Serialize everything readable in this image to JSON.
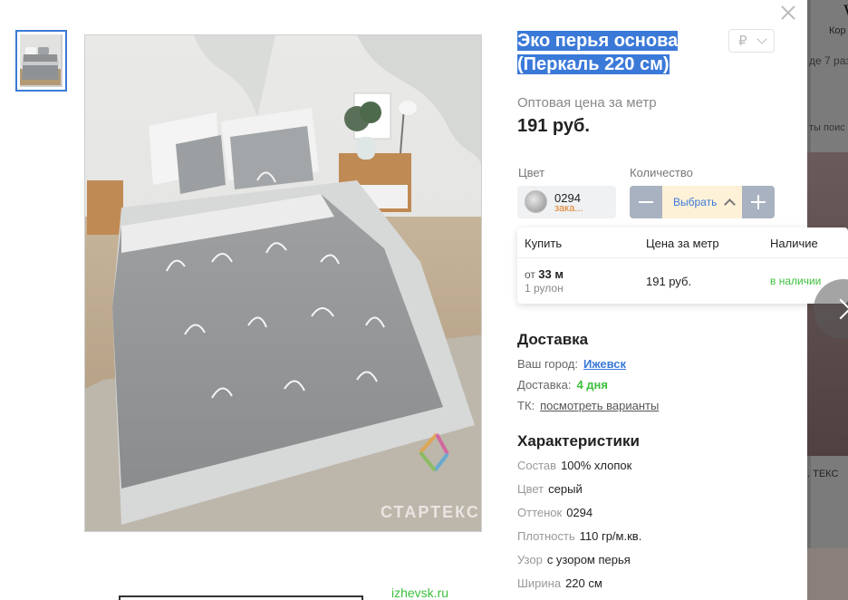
{
  "product": {
    "title": "Эко перья основа (Перкаль 220 см)",
    "currency_symbol": "₽",
    "price_label": "Оптовая цена за метр",
    "price": "191 руб."
  },
  "selectors": {
    "color_label": "Цвет",
    "qty_label": "Количество",
    "color_code": "0294",
    "color_status": "зака...",
    "qty_select": "Выбрать"
  },
  "offers": {
    "headers": [
      "Купить",
      "Цена за метр",
      "Наличие"
    ],
    "from_prefix": "от",
    "from_value": "33 м",
    "roll": "1 рулон",
    "price": "191 руб.",
    "stock": "в наличии"
  },
  "delivery": {
    "heading": "Доставка",
    "city_label": "Ваш город:",
    "city": "Ижевск",
    "time_label": "Доставка:",
    "time": "4 дня",
    "tk_label": "ТК:",
    "tk_link": "посмотреть варианты"
  },
  "characteristics": {
    "heading": "Характеристики",
    "rows": [
      {
        "k": "Состав",
        "v": "100% хлопок"
      },
      {
        "k": "Цвет",
        "v": "серый"
      },
      {
        "k": "Оттенок",
        "v": "0294"
      },
      {
        "k": "Плотность",
        "v": "110 гр/м.кв."
      },
      {
        "k": "Узор",
        "v": "с узором перья"
      },
      {
        "k": "Ширина",
        "v": "220 см"
      }
    ]
  },
  "image": {
    "watermark": "СТАРТЕКС",
    "alt": "bed with feather-pattern bedding"
  },
  "footer": {
    "domain": "izhevsk.ru"
  },
  "background": {
    "big_letter": "W",
    "kor": "Кор",
    "line2": "де 7 раз",
    "line3": "ты поис",
    "line4": ". ТЕКС"
  },
  "icons": {
    "close": "close-icon",
    "next": "chevron-right-icon",
    "currency_chevron": "chevron-down-icon",
    "qty_chevron": "chevron-up-icon"
  },
  "colors": {
    "accent": "#3b79d8",
    "green": "#3cbf3c",
    "orange": "#e07b20",
    "qty_btn": "#a9b2c0"
  }
}
